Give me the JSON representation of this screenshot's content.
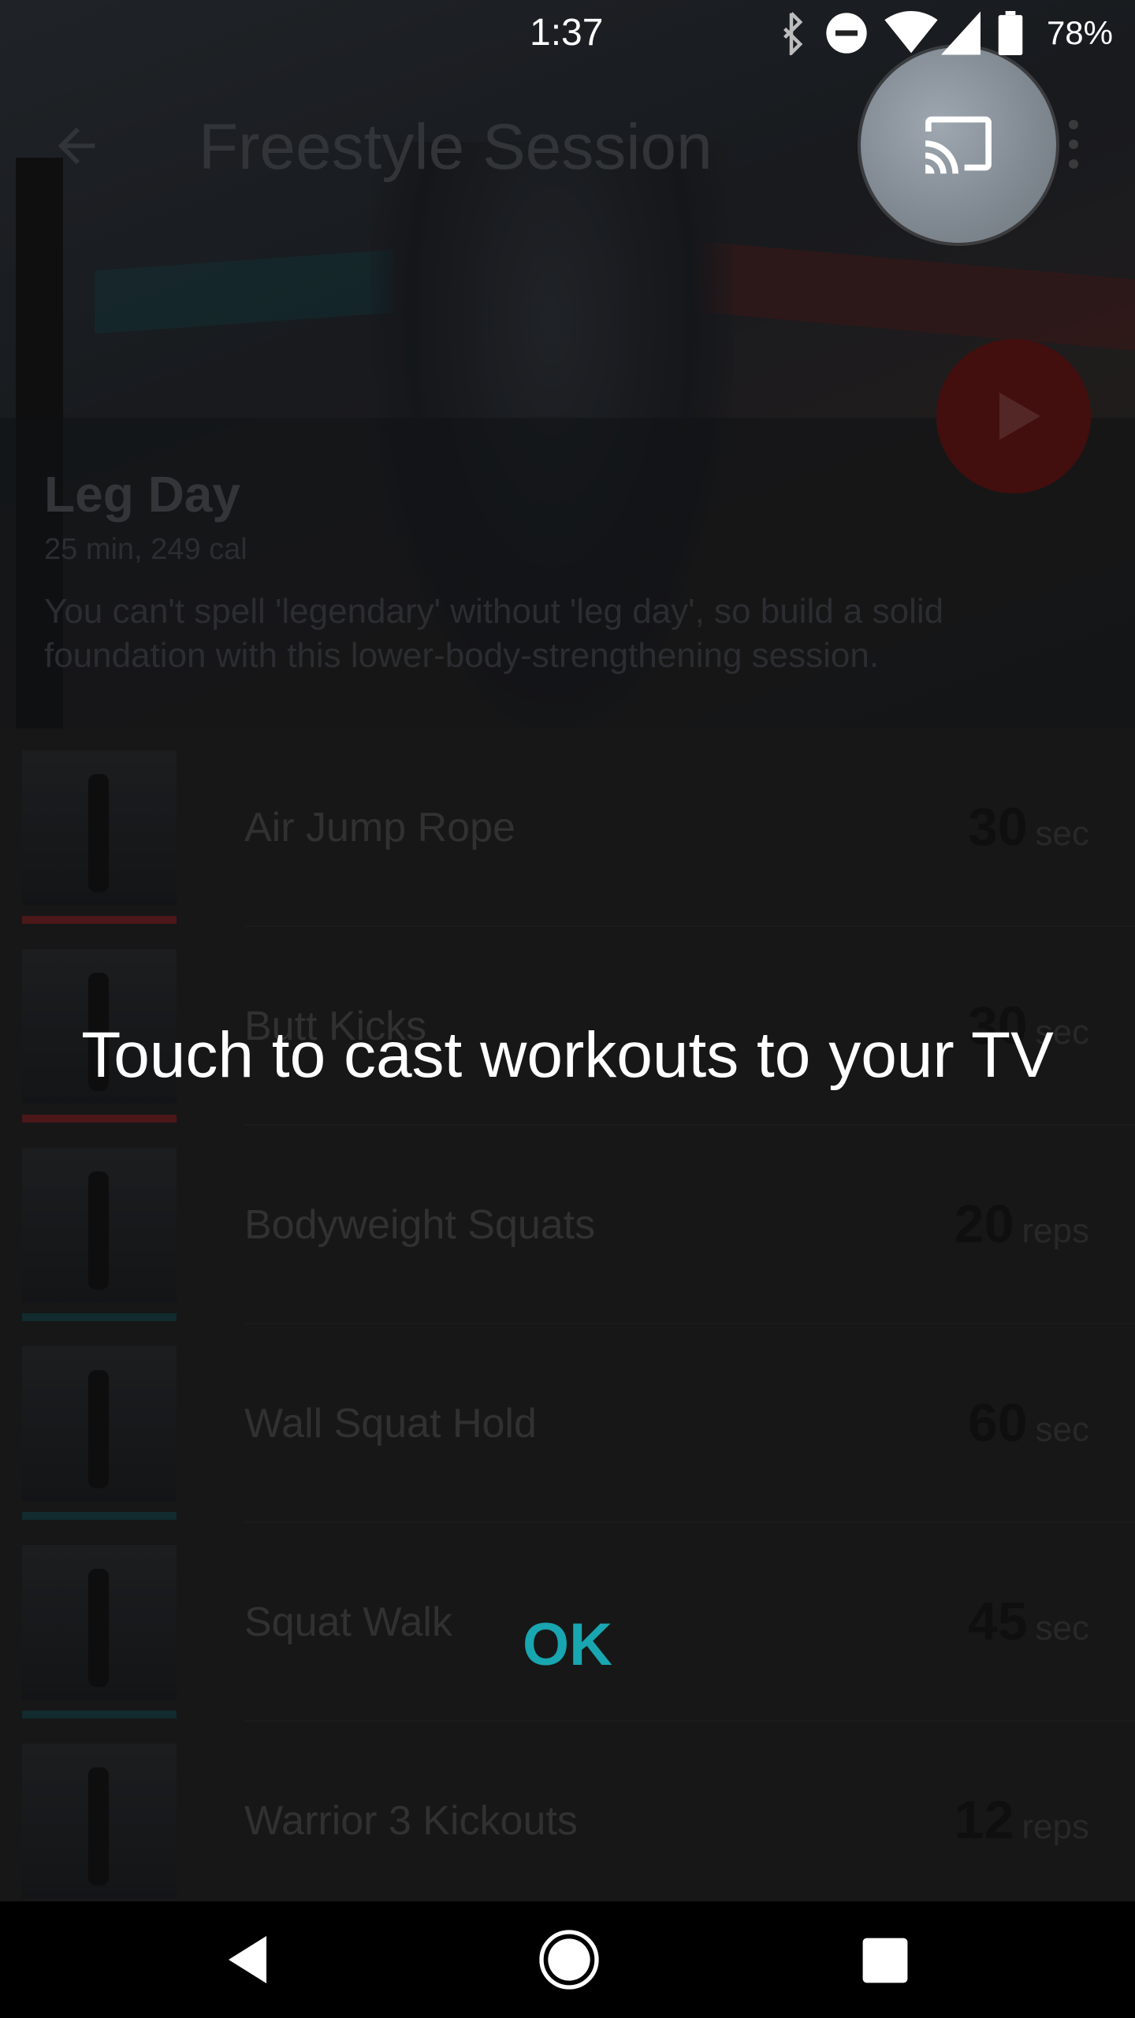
{
  "status_bar": {
    "time": "1:37",
    "battery": "78%",
    "icons": [
      "bluetooth-icon",
      "do-not-disturb-icon",
      "wifi-icon",
      "cell-signal-icon",
      "battery-icon"
    ]
  },
  "header": {
    "title": "Freestyle Session",
    "back_icon": "arrow-back-icon",
    "menu_icon": "more-vert-icon"
  },
  "workout": {
    "title": "Leg Day",
    "meta": "25 min, 249 cal",
    "description": "You can't spell 'legendary' without 'leg day', so build a solid foundation with this lower-body-strengthening session."
  },
  "exercises": [
    {
      "name": "Air Jump Rope",
      "value": "30",
      "unit": "sec",
      "strip_color": "#8a2a2f"
    },
    {
      "name": "Butt Kicks",
      "value": "30",
      "unit": "sec",
      "strip_color": "#8a2a2f"
    },
    {
      "name": "Bodyweight Squats",
      "value": "20",
      "unit": "reps",
      "strip_color": "#1f4f55"
    },
    {
      "name": "Wall Squat Hold",
      "value": "60",
      "unit": "sec",
      "strip_color": "#1f4f55"
    },
    {
      "name": "Squat Walk",
      "value": "45",
      "unit": "sec",
      "strip_color": "#1f4f55"
    },
    {
      "name": "Warrior 3 Kickouts",
      "value": "12",
      "unit": "reps",
      "strip_color": "#1f4f55"
    }
  ],
  "overlay": {
    "message": "Touch to cast workouts to your TV",
    "ok_label": "OK",
    "cast_icon": "cast-icon"
  },
  "nav_bar": {
    "icons": [
      "nav-back-icon",
      "nav-home-icon",
      "nav-recents-icon"
    ]
  },
  "colors": {
    "accent": "#18a6b0",
    "play": "#7a1b1b"
  }
}
